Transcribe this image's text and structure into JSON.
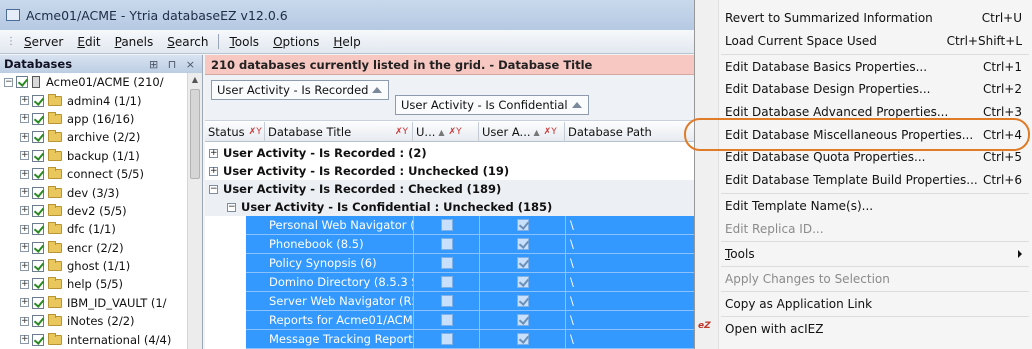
{
  "window": {
    "title": "Acme01/ACME - Ytria databaseEZ v12.0.6"
  },
  "menubar": {
    "items": [
      "Server",
      "Edit",
      "Panels",
      "Search",
      "Tools",
      "Options",
      "Help"
    ]
  },
  "left_panel": {
    "title": "Databases",
    "header_buttons": "⊞ ⊓ ×",
    "root": "Acme01/ACME  (210/",
    "items": [
      "admin4  (1/1)",
      "app  (16/16)",
      "archive  (2/2)",
      "backup  (1/1)",
      "connect  (5/5)",
      "dev  (3/3)",
      "dev2  (5/5)",
      "dfc  (1/1)",
      "encr  (2/2)",
      "ghost  (1/1)",
      "help  (5/5)",
      "IBM_ID_VAULT  (1/",
      "iNotes  (2/2)",
      "international  (4/4)"
    ]
  },
  "grid": {
    "status": "210 databases currently listed in the grid. - Database Title",
    "group_chips": [
      "User Activity - Is Recorded",
      "User Activity - Is Confidential"
    ],
    "columns": [
      "Status",
      "Database Title",
      "U...",
      "User A...",
      "Database Path"
    ],
    "groups": [
      "User Activity - Is Recorded :  (2)",
      "User Activity - Is Recorded : Unchecked (19)",
      "User Activity - Is Recorded : Checked (189)",
      "User Activity - Is Confidential : Unchecked (185)"
    ],
    "rows": [
      {
        "title": "Personal Web Navigator (6)",
        "path": "\\"
      },
      {
        "title": "Phonebook (8.5)",
        "path": "\\"
      },
      {
        "title": "Policy Synopsis (6)",
        "path": "\\"
      },
      {
        "title": "Domino Directory (8.5.3 S...",
        "path": "\\"
      },
      {
        "title": "Server Web Navigator (R5)",
        "path": "\\"
      },
      {
        "title": "Reports for Acme01/ACME",
        "path": "\\"
      },
      {
        "title": "Message Tracking Report...",
        "path": "\\"
      }
    ]
  },
  "context_menu": {
    "items": [
      {
        "label": "Revert to Summarized Information",
        "shortcut": "Ctrl+U"
      },
      {
        "label": "Load Current Space Used",
        "shortcut": "Ctrl+Shift+L"
      },
      {
        "label": "Edit Database Basics Properties...",
        "shortcut": "Ctrl+1"
      },
      {
        "label": "Edit Database Design Properties...",
        "shortcut": "Ctrl+2"
      },
      {
        "label": "Edit Database Advanced Properties...",
        "shortcut": "Ctrl+3"
      },
      {
        "label": "Edit Database Miscellaneous Properties...",
        "shortcut": "Ctrl+4"
      },
      {
        "label": "Edit Database Quota Properties...",
        "shortcut": "Ctrl+5"
      },
      {
        "label": "Edit Database Template Build Properties...",
        "shortcut": "Ctrl+6"
      },
      {
        "label": "Edit Template Name(s)...",
        "shortcut": ""
      },
      {
        "label": "Edit Replica ID...",
        "shortcut": ""
      },
      {
        "label": "Tools",
        "shortcut": ""
      },
      {
        "label": "Apply Changes to Selection",
        "shortcut": ""
      },
      {
        "label": "Copy as Application Link",
        "shortcut": ""
      },
      {
        "label": "Open with acIEZ",
        "shortcut": ""
      }
    ],
    "ez_icon": "eZ"
  },
  "colors": {
    "selection": "#3399ff",
    "status_bar": "#f7c7c2",
    "highlight_ring": "#e07b28"
  }
}
